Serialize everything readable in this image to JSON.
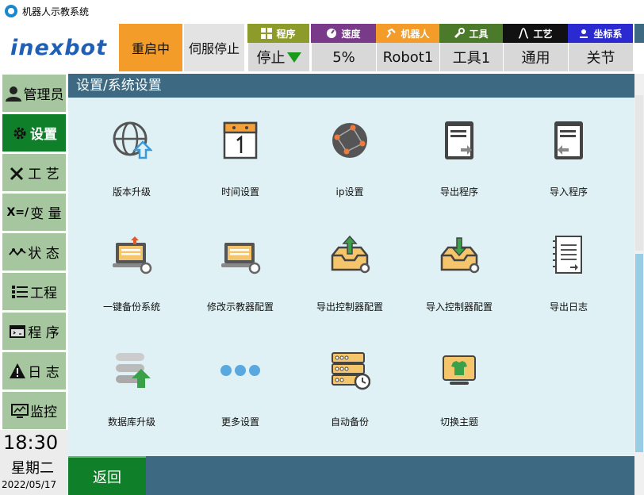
{
  "window": {
    "title": "机器人示教系统"
  },
  "logo": {
    "text": "inexbot"
  },
  "header": {
    "restart_label": "重启中",
    "servo_label": "伺服停止",
    "status": [
      {
        "label": "程序",
        "value": "停止",
        "color": "#8c9b2a",
        "icon": "windows-icon"
      },
      {
        "label": "速度",
        "value": "5%",
        "color": "#7a3a8a",
        "icon": "gauge-icon"
      },
      {
        "label": "机器人",
        "value": "Robot1",
        "color": "#f39c2a",
        "icon": "robot-arm-icon"
      },
      {
        "label": "工具",
        "value": "工具1",
        "color": "#4a7a2a",
        "icon": "wrench-icon"
      },
      {
        "label": "工艺",
        "value": "通用",
        "color": "#111111",
        "icon": "process-icon"
      },
      {
        "label": "坐标系",
        "value": "关节",
        "color": "#2a2ad0",
        "icon": "coordinate-icon"
      }
    ]
  },
  "sidebar": {
    "items": [
      {
        "label": "管理员",
        "icon": "user-icon"
      },
      {
        "label": "设置",
        "icon": "gear-icon",
        "active": true
      },
      {
        "label": "工 艺",
        "icon": "tools-icon"
      },
      {
        "label": "变 量",
        "prefix": "X=/",
        "icon": "variable-icon"
      },
      {
        "label": "状 态",
        "icon": "wave-icon"
      },
      {
        "label": "工程",
        "icon": "list-icon"
      },
      {
        "label": "程 序",
        "icon": "code-icon"
      },
      {
        "label": "日 志",
        "icon": "warning-icon"
      },
      {
        "label": "监控",
        "icon": "monitor-icon"
      }
    ]
  },
  "clock": {
    "time": "18:30",
    "weekday": "星期二",
    "date": "2022/05/17"
  },
  "main": {
    "breadcrumb": "设置/系统设置",
    "items": [
      {
        "label": "版本升级",
        "icon": "globe-upgrade-icon"
      },
      {
        "label": "时间设置",
        "icon": "calendar-icon"
      },
      {
        "label": "ip设置",
        "icon": "network-globe-icon"
      },
      {
        "label": "导出程序",
        "icon": "export-program-icon"
      },
      {
        "label": "导入程序",
        "icon": "import-program-icon"
      },
      {
        "label": "一键备份系统",
        "icon": "laptop-backup-icon"
      },
      {
        "label": "修改示教器配置",
        "icon": "laptop-settings-icon"
      },
      {
        "label": "导出控制器配置",
        "icon": "tray-export-icon"
      },
      {
        "label": "导入控制器配置",
        "icon": "tray-import-icon"
      },
      {
        "label": "导出日志",
        "icon": "log-notebook-icon"
      },
      {
        "label": "数据库升级",
        "icon": "database-upgrade-icon"
      },
      {
        "label": "更多设置",
        "icon": "more-dots-icon"
      },
      {
        "label": "自动备份",
        "icon": "server-clock-icon"
      },
      {
        "label": "切换主题",
        "icon": "theme-icon"
      }
    ]
  },
  "footer": {
    "back_label": "返回"
  },
  "colors": {
    "accent_green": "#0f7f2a",
    "panel_bg": "#dff1f4",
    "header_bar": "#3d6a82",
    "restart_orange": "#f39c2a"
  }
}
